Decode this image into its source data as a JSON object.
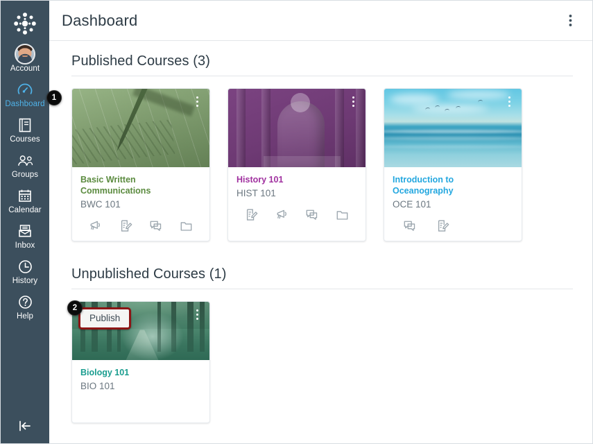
{
  "app": {
    "name": "Canvas LMS",
    "logo_icon": "canvas-logo-icon"
  },
  "sidebar": {
    "account": {
      "label": "Account",
      "icon": "user-avatar-icon"
    },
    "items": [
      {
        "label": "Dashboard",
        "icon": "dashboard-gauge-icon",
        "active": true
      },
      {
        "label": "Courses",
        "icon": "courses-book-icon",
        "active": false
      },
      {
        "label": "Groups",
        "icon": "groups-people-icon",
        "active": false
      },
      {
        "label": "Calendar",
        "icon": "calendar-icon",
        "active": false
      },
      {
        "label": "Inbox",
        "icon": "inbox-envelope-icon",
        "active": false
      },
      {
        "label": "History",
        "icon": "history-clock-icon",
        "active": false
      },
      {
        "label": "Help",
        "icon": "help-question-icon",
        "active": false
      }
    ],
    "collapse": {
      "label": "Minimize navigation",
      "icon": "collapse-left-arrow-icon"
    },
    "active_color": "#4fb2e8",
    "background_color": "#3c4f5d"
  },
  "header": {
    "title": "Dashboard",
    "options_icon": "kebab-menu-icon"
  },
  "sections": [
    {
      "key": "published",
      "title": "Published Courses (3)"
    },
    {
      "key": "unpublished",
      "title": "Unpublished Courses (1)"
    }
  ],
  "published_courses": [
    {
      "name": "Basic Written Communications",
      "code": "BWC 101",
      "color": "#5b8b3f",
      "banner": "writing-pen-photo",
      "options_icon": "kebab-menu-icon",
      "actions": [
        {
          "name": "Announcements",
          "icon": "announcements-megaphone-icon"
        },
        {
          "name": "Assignments",
          "icon": "assignments-paper-pencil-icon"
        },
        {
          "name": "Discussions",
          "icon": "discussions-speech-bubble-icon"
        },
        {
          "name": "Files",
          "icon": "files-folder-icon"
        }
      ]
    },
    {
      "name": "History 101",
      "code": "HIST 101",
      "color": "#a0309f",
      "banner": "lincoln-memorial-photo",
      "options_icon": "kebab-menu-icon",
      "actions": [
        {
          "name": "Assignments",
          "icon": "assignments-paper-pencil-icon"
        },
        {
          "name": "Announcements",
          "icon": "announcements-megaphone-icon"
        },
        {
          "name": "Discussions",
          "icon": "discussions-speech-bubble-icon"
        },
        {
          "name": "Files",
          "icon": "files-folder-icon"
        }
      ]
    },
    {
      "name": "Introduction to Oceanography",
      "code": "OCE 101",
      "color": "#23a7df",
      "banner": "ocean-horizon-photo",
      "options_icon": "kebab-menu-icon",
      "actions": [
        {
          "name": "Discussions",
          "icon": "discussions-speech-bubble-icon"
        },
        {
          "name": "Assignments",
          "icon": "assignments-paper-pencil-icon"
        }
      ]
    }
  ],
  "unpublished_courses": [
    {
      "name": "Biology 101",
      "code": "BIO 101",
      "color": "#1a9d8f",
      "banner": "forest-path-photo",
      "options_icon": "kebab-menu-icon",
      "publish_label": "Publish",
      "publish_highlight_color": "#8c1515",
      "actions": []
    }
  ],
  "callouts": [
    {
      "number": "1",
      "target": "Dashboard"
    },
    {
      "number": "2",
      "target": "Publish"
    }
  ]
}
